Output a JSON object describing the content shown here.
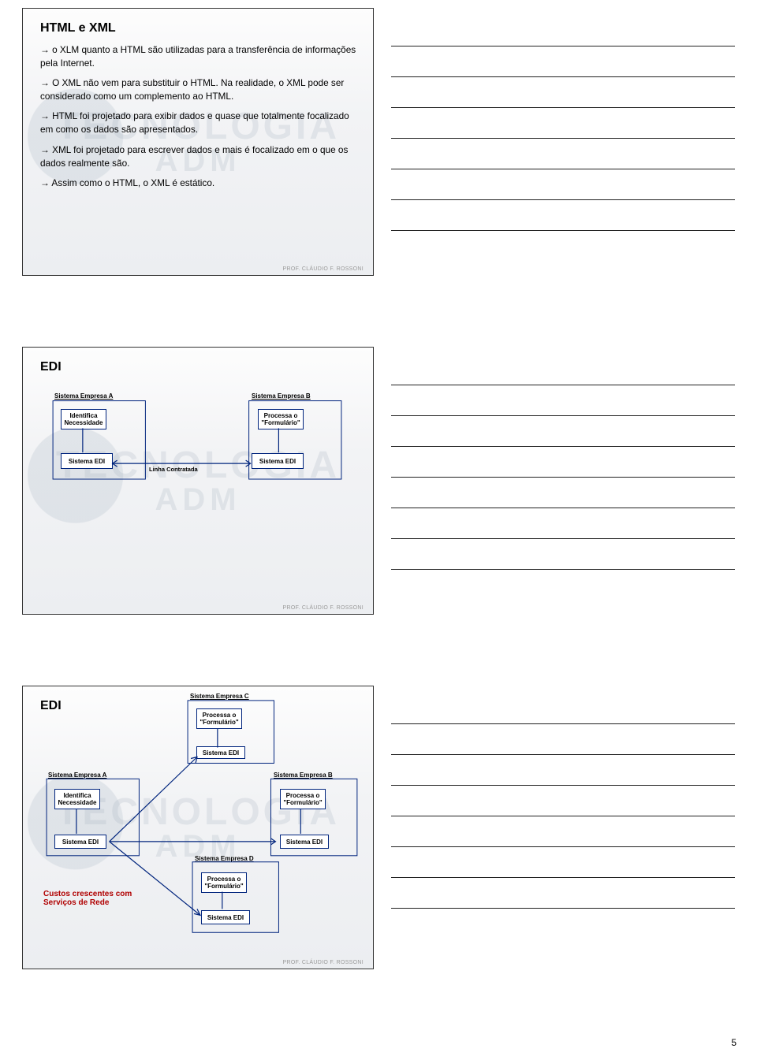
{
  "pageNumber": "5",
  "watermark": {
    "line1": "TECNOLOGIA",
    "line2": "ADM"
  },
  "footer": "PROF. CLÁUDIO F. ROSSONI",
  "slide1": {
    "title": "HTML e XML",
    "b1": "→ o XLM quanto a HTML são utilizadas para a transferência de informações pela Internet.",
    "b2": "→ O XML não vem para substituir o HTML. Na realidade, o XML pode ser considerado como um complemento ao HTML.",
    "b3": "→  HTML foi projetado para exibir dados e quase que totalmente focalizado em como os dados são apresentados.",
    "b4": "→ XML  foi projetado para escrever dados e mais é focalizado em o que os dados realmente são.",
    "b5": "→ Assim como o HTML, o XML é estático."
  },
  "slide2": {
    "title": "EDI",
    "labels": {
      "empA": "Sistema Empresa A",
      "empB": "Sistema Empresa B",
      "ident": "Identifica Necessidade",
      "proc": "Processa o \"Formulário\"",
      "sedi": "Sistema EDI",
      "linha": "Linha Contratada"
    }
  },
  "slide3": {
    "title": "EDI",
    "labels": {
      "empA": "Sistema Empresa A",
      "empB": "Sistema Empresa B",
      "empC": "Sistema Empresa C",
      "empD": "Sistema Empresa D",
      "ident": "Identifica Necessidade",
      "proc": "Processa o \"Formulário\"",
      "sedi": "Sistema EDI",
      "note": "Custos crescentes com Serviços de Rede"
    }
  }
}
